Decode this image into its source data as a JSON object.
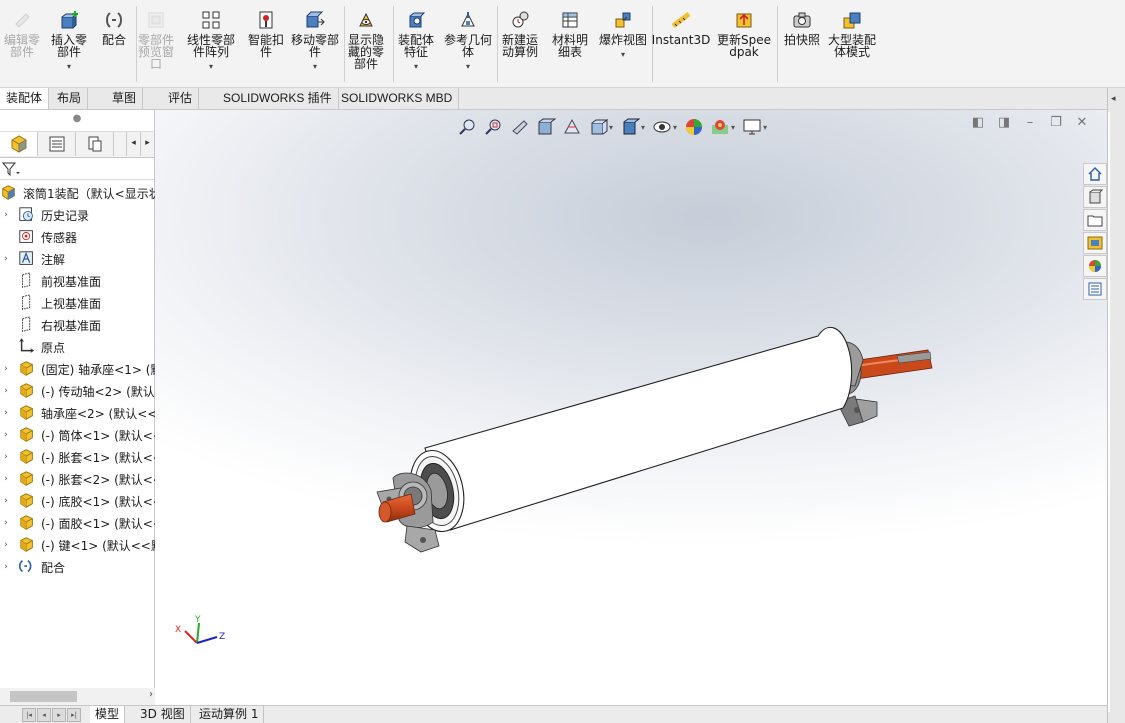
{
  "ribbon": {
    "buttons": [
      {
        "label": "编辑零部件",
        "icon": "edit-component-icon",
        "enabled": false,
        "dropdown": false
      },
      {
        "label": "插入零部件",
        "icon": "insert-components-icon",
        "enabled": true,
        "dropdown": true
      },
      {
        "label": "配合",
        "icon": "mate-icon",
        "enabled": true,
        "dropdown": false
      },
      {
        "label": "零部件预览窗口",
        "icon": "component-preview-icon",
        "enabled": false,
        "dropdown": false
      },
      {
        "label": "线性零部件阵列",
        "icon": "linear-pattern-icon",
        "enabled": true,
        "dropdown": true
      },
      {
        "label": "智能扣件",
        "icon": "smart-fasteners-icon",
        "enabled": true,
        "dropdown": false
      },
      {
        "label": "移动零部件",
        "icon": "move-component-icon",
        "enabled": true,
        "dropdown": true
      },
      {
        "label": "显示隐藏的零部件",
        "icon": "show-hidden-icon",
        "enabled": true,
        "dropdown": false
      },
      {
        "label": "装配体特征",
        "icon": "assembly-features-icon",
        "enabled": true,
        "dropdown": true
      },
      {
        "label": "参考几何体",
        "icon": "reference-geometry-icon",
        "enabled": true,
        "dropdown": true
      },
      {
        "label": "新建运动算例",
        "icon": "new-motion-study-icon",
        "enabled": true,
        "dropdown": false
      },
      {
        "label": "材料明细表",
        "icon": "bill-of-materials-icon",
        "enabled": true,
        "dropdown": false
      },
      {
        "label": "爆炸视图",
        "icon": "exploded-view-icon",
        "enabled": true,
        "dropdown": true
      },
      {
        "label": "Instant3D",
        "icon": "instant3d-icon",
        "enabled": true,
        "dropdown": false
      },
      {
        "label": "更新Speedpak",
        "icon": "update-speedpak-icon",
        "enabled": true,
        "dropdown": false
      },
      {
        "label": "拍快照",
        "icon": "take-snapshot-icon",
        "enabled": true,
        "dropdown": false
      },
      {
        "label": "大型装配体模式",
        "icon": "large-assembly-icon",
        "enabled": true,
        "dropdown": false
      }
    ]
  },
  "command_tabs": [
    "装配体",
    "布局",
    "草图",
    "评估",
    "SOLIDWORKS 插件",
    "SOLIDWORKS MBD"
  ],
  "command_tabs_active": "装配体",
  "feature_tree": {
    "root": "滚筒1装配（默认<显示状",
    "items": [
      {
        "label": "历史记录",
        "icon": "history-icon",
        "expandable": true
      },
      {
        "label": "传感器",
        "icon": "sensor-icon",
        "expandable": false
      },
      {
        "label": "注解",
        "icon": "annotations-icon",
        "expandable": true
      },
      {
        "label": "前视基准面",
        "icon": "plane-icon",
        "expandable": false
      },
      {
        "label": "上视基准面",
        "icon": "plane-icon",
        "expandable": false
      },
      {
        "label": "右视基准面",
        "icon": "plane-icon",
        "expandable": false
      },
      {
        "label": "原点",
        "icon": "origin-icon",
        "expandable": false
      },
      {
        "label": "(固定) 轴承座<1> (默",
        "icon": "part-icon",
        "expandable": true
      },
      {
        "label": "(-) 传动轴<2> (默认<",
        "icon": "part-icon",
        "expandable": true
      },
      {
        "label": "轴承座<2> (默认<<默",
        "icon": "part-icon",
        "expandable": true
      },
      {
        "label": "(-) 筒体<1> (默认<<",
        "icon": "part-icon",
        "expandable": true
      },
      {
        "label": "(-) 胀套<1> (默认<<",
        "icon": "part-icon",
        "expandable": true
      },
      {
        "label": "(-) 胀套<2> (默认<<",
        "icon": "part-icon",
        "expandable": true
      },
      {
        "label": "(-) 底胶<1> (默认<<",
        "icon": "part-icon",
        "expandable": true
      },
      {
        "label": "(-) 面胶<1> (默认<<",
        "icon": "part-icon",
        "expandable": true
      },
      {
        "label": "(-) 键<1> (默认<<默",
        "icon": "part-icon",
        "expandable": true
      },
      {
        "label": "配合",
        "icon": "mates-folder-icon",
        "expandable": true
      }
    ]
  },
  "bottom_tabs": [
    "模型",
    "3D 视图",
    "运动算例 1"
  ],
  "bottom_tabs_active": "模型",
  "triad_axes": [
    "X",
    "Y",
    "Z"
  ],
  "colors": {
    "accent": "#2d6fb5",
    "shaft": "#c9491b",
    "roller": "#ffffff",
    "bearing_housing": "#8a8a8a"
  }
}
